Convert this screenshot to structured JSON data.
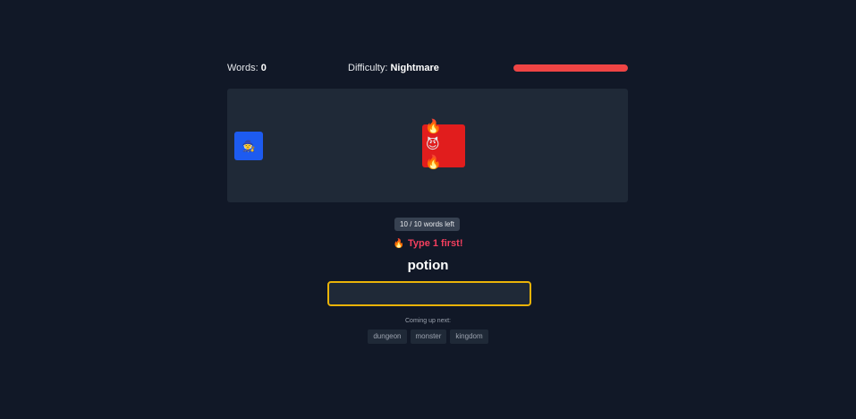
{
  "hud": {
    "words_label": "Words:",
    "words_value": "0",
    "difficulty_label": "Difficulty:",
    "difficulty_value": "Nightmare",
    "enemy_health_fraction": 1.0,
    "health_color": "#ef4444"
  },
  "arena": {
    "player_icon": "🧙",
    "enemy_face_icon": "😈",
    "enemy_status_icon": "🔥",
    "player_color": "#1d5bf0",
    "enemy_color": "#e11d1d"
  },
  "counter": "10 / 10 words left",
  "warning": {
    "icon": "🔥",
    "text": "Type 1 first!"
  },
  "target_word": "potion",
  "input": {
    "value": "",
    "placeholder": ""
  },
  "next": {
    "label": "Coming up next:",
    "words": [
      "dungeon",
      "monster",
      "kingdom"
    ]
  }
}
